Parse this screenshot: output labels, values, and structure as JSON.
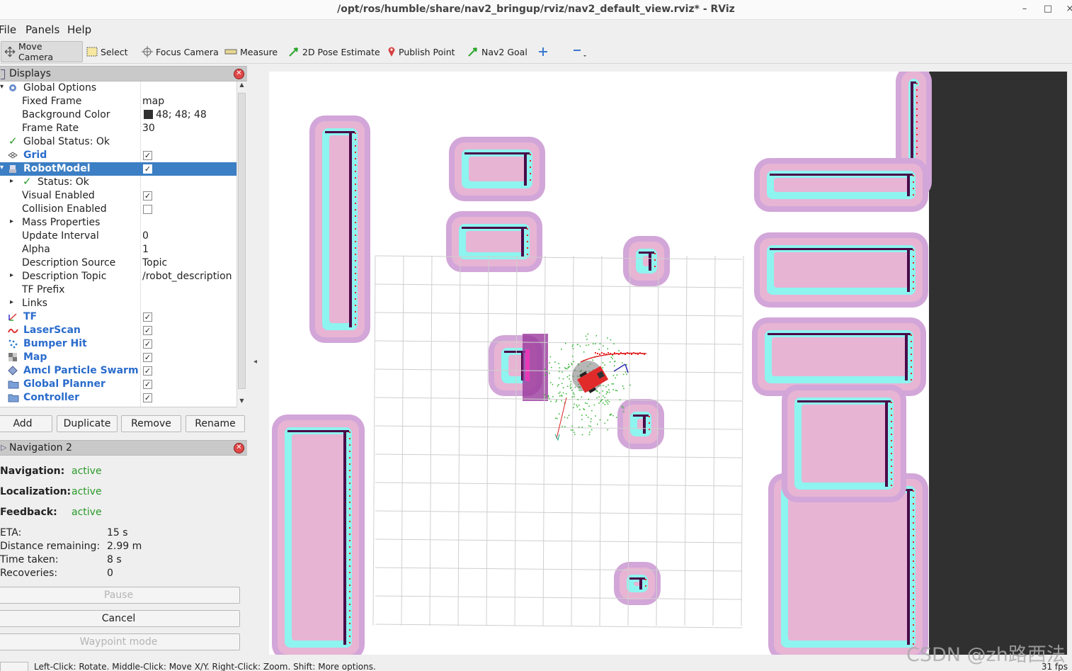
{
  "window": {
    "title": "/opt/ros/humble/share/nav2_bringup/rviz/nav2_default_view.rviz* - RViz",
    "minimize": "–",
    "maximize": "□",
    "close": "×"
  },
  "menu": [
    "File",
    "Panels",
    "Help"
  ],
  "toolbar": {
    "move_camera": "Move Camera",
    "select": "Select",
    "focus_camera": "Focus Camera",
    "measure": "Measure",
    "pose_estimate": "2D Pose Estimate",
    "publish_point": "Publish Point",
    "nav2_goal": "Nav2 Goal"
  },
  "displays": {
    "title": "Displays",
    "rows": [
      {
        "label": "Global Options",
        "value": ""
      },
      {
        "label": "Fixed Frame",
        "value": "map"
      },
      {
        "label": "Background Color",
        "value": "48; 48; 48"
      },
      {
        "label": "Frame Rate",
        "value": "30"
      },
      {
        "label": "Global Status: Ok",
        "value": ""
      },
      {
        "label": "Grid",
        "value": ""
      },
      {
        "label": "RobotModel",
        "value": ""
      },
      {
        "label": "Status: Ok",
        "value": ""
      },
      {
        "label": "Visual Enabled",
        "value": ""
      },
      {
        "label": "Collision Enabled",
        "value": ""
      },
      {
        "label": "Mass Properties",
        "value": ""
      },
      {
        "label": "Update Interval",
        "value": "0"
      },
      {
        "label": "Alpha",
        "value": "1"
      },
      {
        "label": "Description Source",
        "value": "Topic"
      },
      {
        "label": "Description Topic",
        "value": "/robot_description"
      },
      {
        "label": "TF Prefix",
        "value": ""
      },
      {
        "label": "Links",
        "value": ""
      },
      {
        "label": "TF",
        "value": ""
      },
      {
        "label": "LaserScan",
        "value": ""
      },
      {
        "label": "Bumper Hit",
        "value": ""
      },
      {
        "label": "Map",
        "value": ""
      },
      {
        "label": "Amcl Particle Swarm",
        "value": ""
      },
      {
        "label": "Global Planner",
        "value": ""
      },
      {
        "label": "Controller",
        "value": ""
      }
    ],
    "buttons": {
      "add": "Add",
      "duplicate": "Duplicate",
      "remove": "Remove",
      "rename": "Rename"
    }
  },
  "navigation": {
    "title": "Navigation 2",
    "navigation_label": "Navigation:",
    "navigation_value": "active",
    "localization_label": "Localization:",
    "localization_value": "active",
    "feedback_label": "Feedback:",
    "feedback_value": "active",
    "eta_label": "ETA:",
    "eta_value": "15 s",
    "distance_label": "Distance remaining:",
    "distance_value": "2.99 m",
    "time_label": "Time taken:",
    "time_value": "8 s",
    "recoveries_label": "Recoveries:",
    "recoveries_value": "0",
    "pause": "Pause",
    "cancel": "Cancel",
    "waypoint": "Waypoint mode"
  },
  "status": {
    "hint": "Left-Click: Rotate. Middle-Click: Move X/Y. Right-Click: Zoom. Shift: More options.",
    "fps": "31 fps"
  },
  "watermark": "CSDN @zh路西法",
  "colors": {
    "selection": "#3c7fc4",
    "panel_header": "#c9c9c9",
    "costmap_outer": "#d2a6d8",
    "costmap_mid": "#e7b4d4",
    "costmap_inner": "#8ef4ef",
    "obstacle": "#4a0a48",
    "robot": "#e12b2b",
    "active_status": "#2a9a2a"
  }
}
